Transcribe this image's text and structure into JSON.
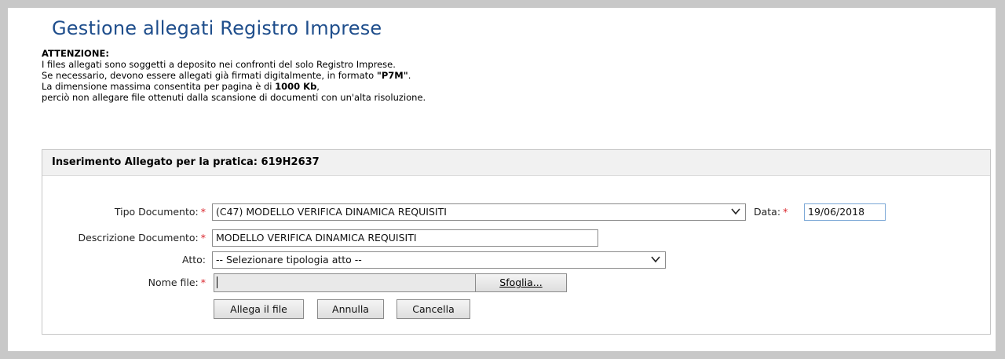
{
  "page": {
    "title": "Gestione allegati Registro Imprese"
  },
  "notice": {
    "heading": "ATTENZIONE:",
    "line1": "I files allegati sono soggetti a deposito nei confronti del solo Registro Imprese.",
    "line2_pre": "Se necessario, devono essere allegati già firmati digitalmente, in formato ",
    "line2_bold": "\"P7M\"",
    "line2_post": ".",
    "line3_pre": "La dimensione massima consentita per pagina è di ",
    "line3_bold": "1000 Kb",
    "line3_post": ",",
    "line4": "perciò non allegare file ottenuti dalla scansione di documenti con un'alta risoluzione."
  },
  "form": {
    "header": "Inserimento Allegato per la pratica: 619H2637",
    "required_mark": "*",
    "tipo_documento": {
      "label": "Tipo Documento:",
      "value": "(C47) MODELLO VERIFICA DINAMICA REQUISITI"
    },
    "data": {
      "label": "Data:",
      "value": "19/06/2018"
    },
    "descrizione": {
      "label": "Descrizione Documento:",
      "value": "MODELLO VERIFICA DINAMICA REQUISITI"
    },
    "atto": {
      "label": "Atto:",
      "value": "-- Selezionare tipologia atto --"
    },
    "nome_file": {
      "label": "Nome file:",
      "value": "",
      "browse_label": "Sfoglia..."
    },
    "buttons": {
      "allega": "Allega il file",
      "annulla": "Annulla",
      "cancella": "Cancella"
    }
  },
  "colors": {
    "title": "#1f4e8c",
    "required": "#d9232a"
  }
}
